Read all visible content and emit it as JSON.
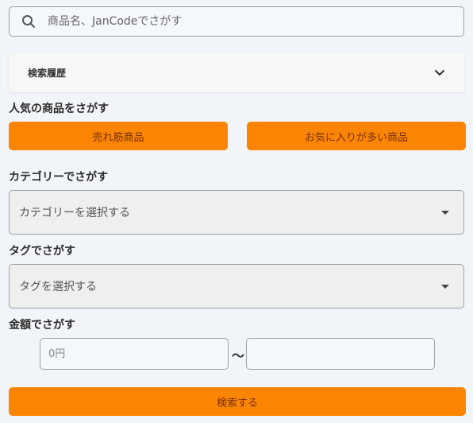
{
  "search": {
    "placeholder": "商品名、JanCodeでさがす",
    "value": ""
  },
  "history": {
    "label": "検索履歴"
  },
  "popular": {
    "title": "人気の商品をさがす",
    "buttons": [
      "売れ筋商品",
      "お気に入りが多い商品"
    ]
  },
  "category": {
    "title": "カテゴリーでさがす",
    "placeholder": "カテゴリーを選択する"
  },
  "tag": {
    "title": "タグでさがす",
    "placeholder": "タグを選択する"
  },
  "price": {
    "title": "金額でさがす",
    "min_placeholder": "0円",
    "max_placeholder": "",
    "separator": "〜"
  },
  "search_button": "検索する",
  "colors": {
    "accent": "#fb8500",
    "page_bg": "#f1f4f8"
  },
  "icons": {
    "search": "search-icon",
    "history_toggle": "chevron-down-icon",
    "select_arrow": "triangle-down-icon"
  }
}
